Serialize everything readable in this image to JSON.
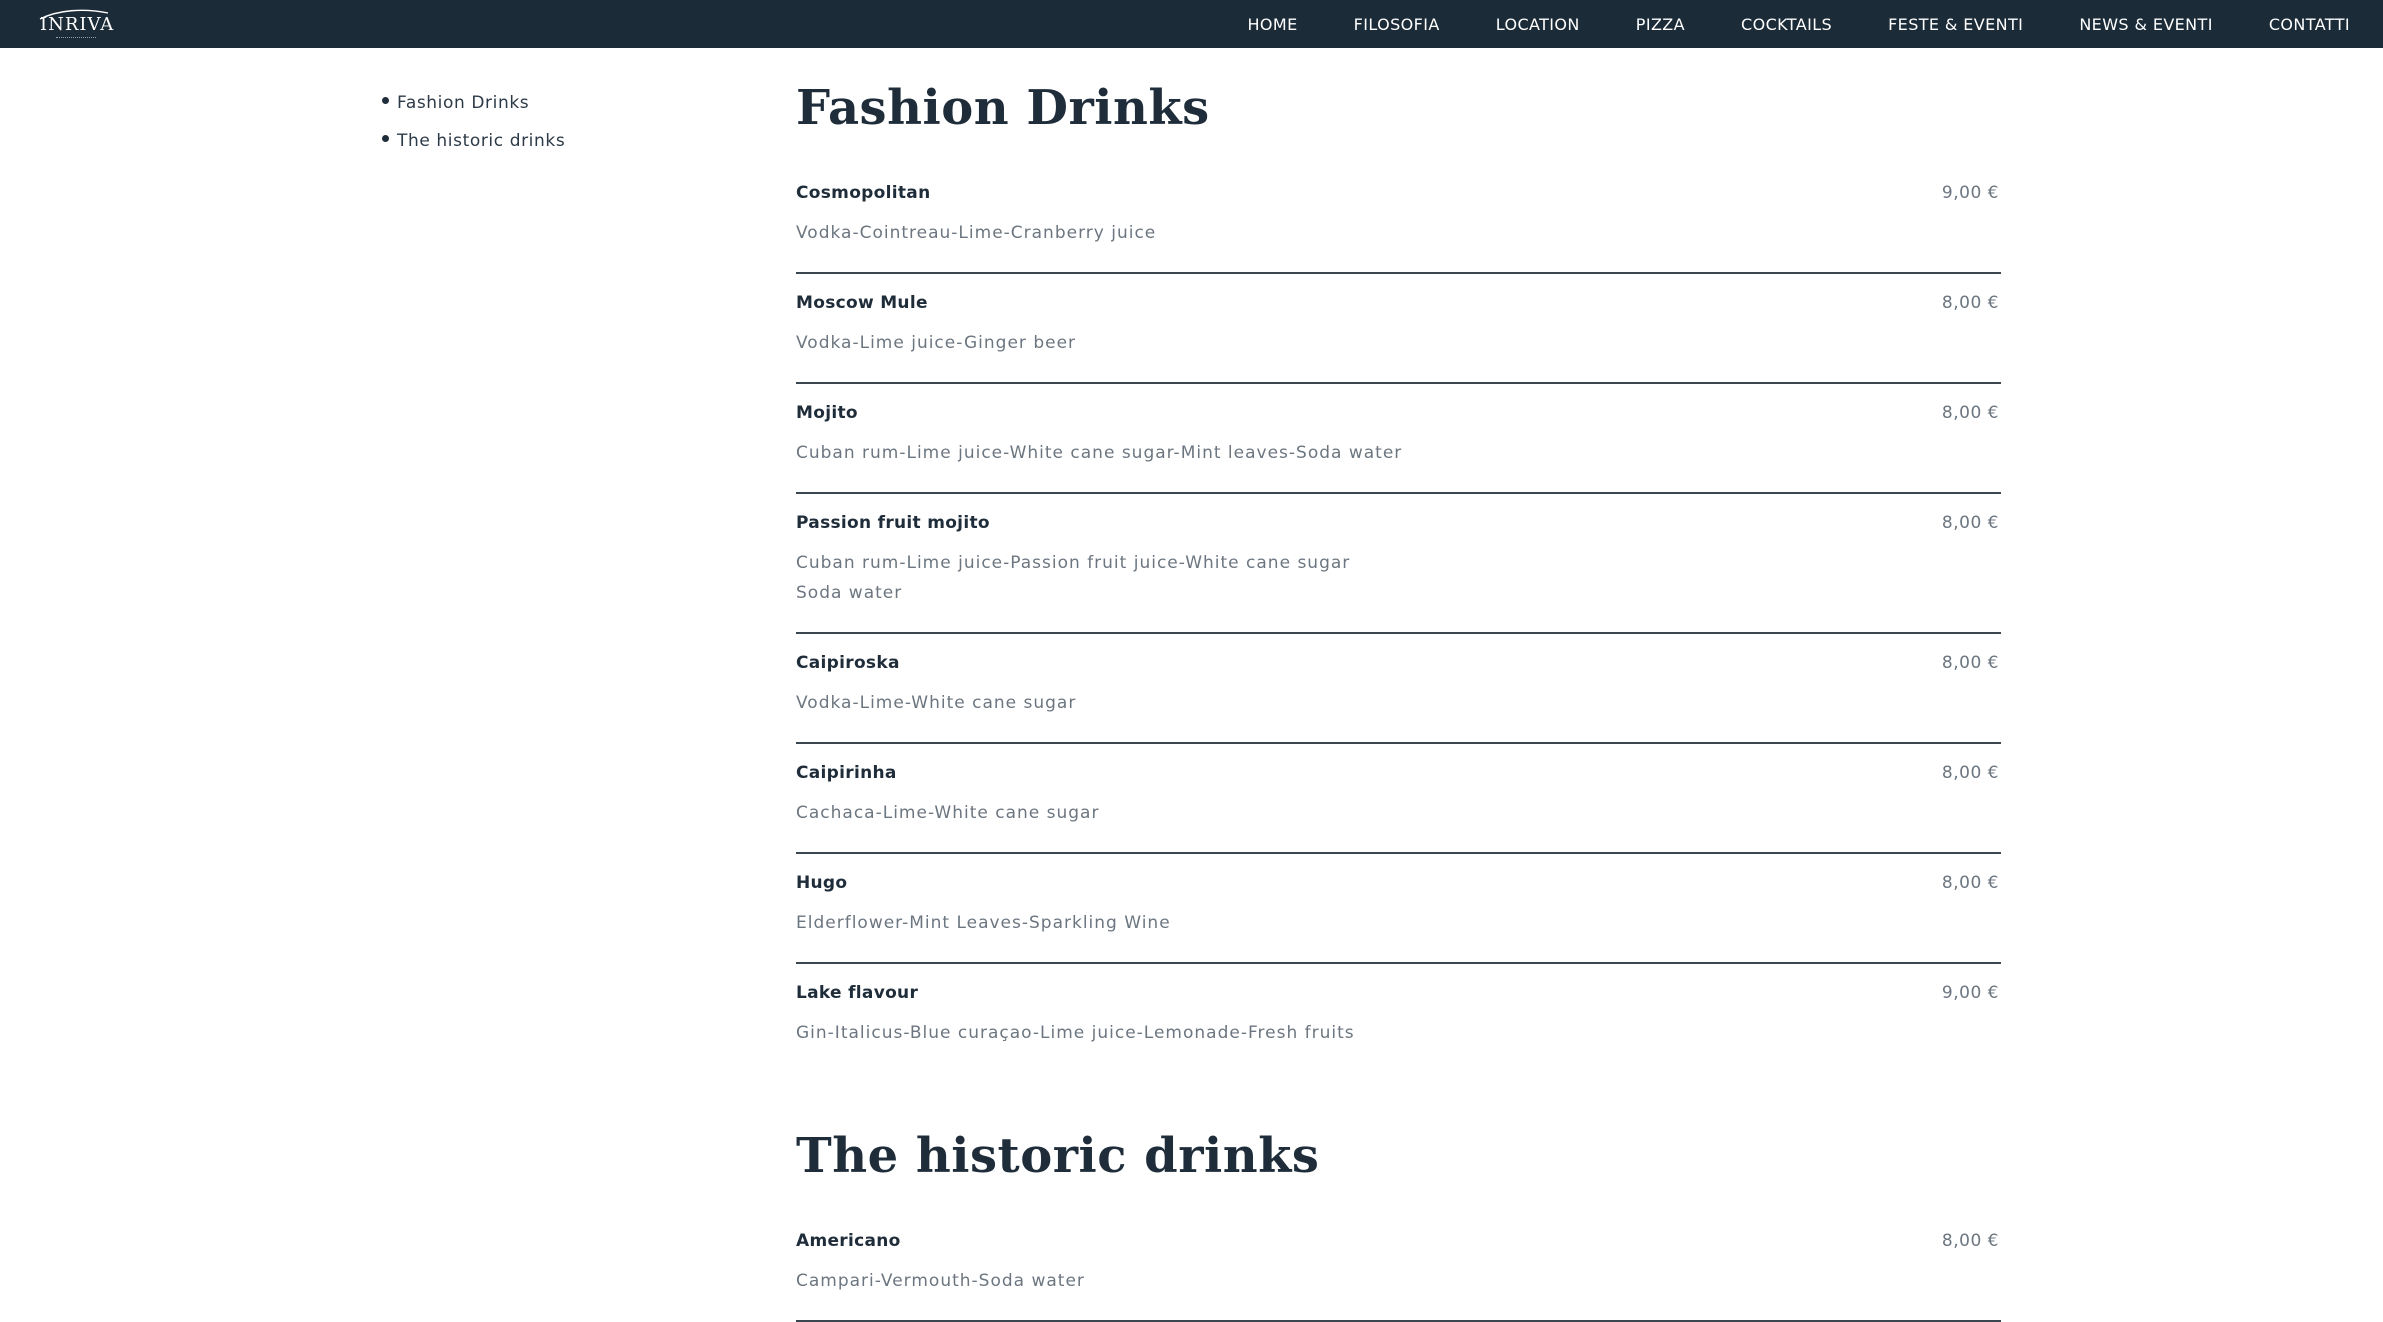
{
  "header": {
    "logo_text": "INRIVA",
    "nav": [
      "HOME",
      "FILOSOFIA",
      "LOCATION",
      "PIZZA",
      "COCKTAILS",
      "FESTE & EVENTI",
      "NEWS & EVENTI",
      "CONTATTI"
    ]
  },
  "sidebar": {
    "items": [
      "Fashion Drinks",
      "The historic drinks"
    ]
  },
  "sections": [
    {
      "title": "Fashion Drinks",
      "items": [
        {
          "name": "Cosmopolitan",
          "price": "9,00 €",
          "desc": [
            "Vodka-Cointreau-Lime-Cranberry juice"
          ]
        },
        {
          "name": "Moscow Mule",
          "price": "8,00 €",
          "desc": [
            "Vodka-Lime juice-Ginger beer"
          ]
        },
        {
          "name": "Mojito",
          "price": "8,00 €",
          "desc": [
            "Cuban rum-Lime juice-White cane sugar-Mint leaves-Soda water"
          ]
        },
        {
          "name": "Passion fruit mojito",
          "price": "8,00 €",
          "desc": [
            "Cuban rum-Lime juice-Passion fruit juice-White cane sugar",
            "Soda water"
          ]
        },
        {
          "name": "Caipiroska",
          "price": "8,00 €",
          "desc": [
            "Vodka-Lime-White cane sugar"
          ]
        },
        {
          "name": "Caipirinha",
          "price": "8,00 €",
          "desc": [
            "Cachaca-Lime-White cane sugar"
          ]
        },
        {
          "name": "Hugo",
          "price": "8,00 €",
          "desc": [
            "Elderflower-Mint Leaves-Sparkling Wine"
          ]
        },
        {
          "name": "Lake flavour",
          "price": "9,00 €",
          "desc": [
            "Gin-Italicus-Blue curaçao-Lime juice-Lemonade-Fresh fruits"
          ]
        }
      ]
    },
    {
      "title": "The historic drinks",
      "items": [
        {
          "name": "Americano",
          "price": "8,00 €",
          "desc": [
            "Campari-Vermouth-Soda water"
          ]
        }
      ]
    }
  ],
  "colors": {
    "nav_bg": "#1b2b38",
    "text_dark": "#1f2d3a",
    "text_muted": "#6c7680",
    "divider": "#3a4650"
  }
}
